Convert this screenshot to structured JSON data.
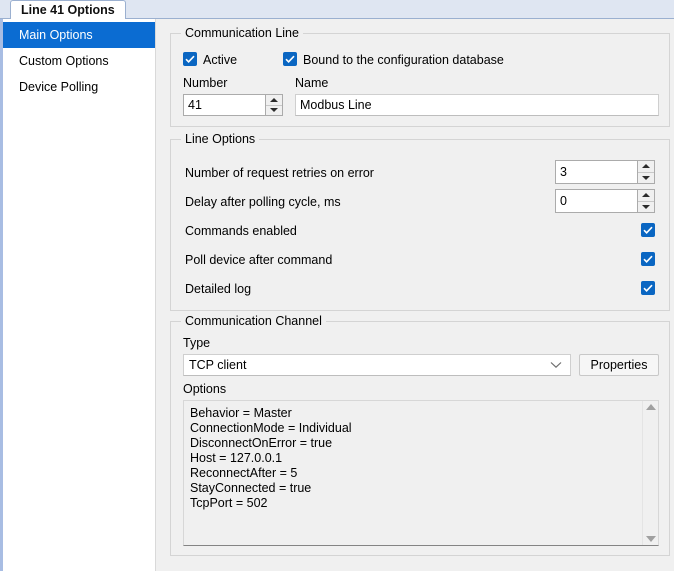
{
  "window": {
    "tab_label": "Line 41 Options"
  },
  "sidebar": {
    "items": [
      {
        "label": "Main Options",
        "selected": true
      },
      {
        "label": "Custom Options",
        "selected": false
      },
      {
        "label": "Device Polling",
        "selected": false
      }
    ]
  },
  "communication_line": {
    "legend": "Communication Line",
    "active": {
      "label": "Active",
      "checked": true
    },
    "bound": {
      "label": "Bound to the configuration database",
      "checked": true
    },
    "number": {
      "label": "Number",
      "value": "41"
    },
    "name": {
      "label": "Name",
      "value": "Modbus Line"
    }
  },
  "line_options": {
    "legend": "Line Options",
    "retries": {
      "label": "Number of request retries on error",
      "value": "3"
    },
    "delay": {
      "label": "Delay after polling cycle, ms",
      "value": "0"
    },
    "commands_enabled": {
      "label": "Commands enabled",
      "checked": true
    },
    "poll_after_command": {
      "label": "Poll device after command",
      "checked": true
    },
    "detailed_log": {
      "label": "Detailed log",
      "checked": true
    }
  },
  "communication_channel": {
    "legend": "Communication Channel",
    "type_label": "Type",
    "type_value": "TCP client",
    "properties_button": "Properties",
    "options_label": "Options",
    "options_lines": [
      "Behavior = Master",
      "ConnectionMode = Individual",
      "DisconnectOnError = true",
      "Host = 127.0.0.1",
      "ReconnectAfter = 5",
      "StayConnected = true",
      "TcpPort = 502"
    ]
  },
  "colors": {
    "accent": "#0b6cd2",
    "checkbox": "#0a66c2",
    "panel": "#f0f0f0",
    "tabstrip": "#dfe6f2"
  }
}
